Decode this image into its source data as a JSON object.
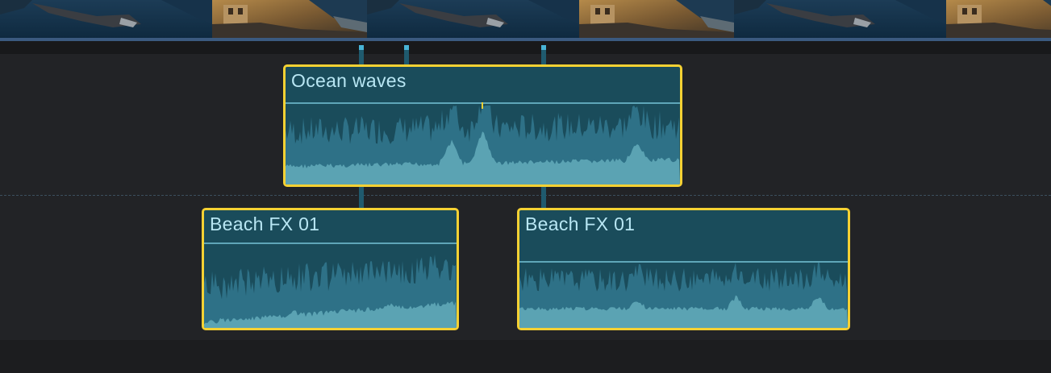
{
  "timeline": {
    "clips": [
      {
        "title": "Ocean waves",
        "selected": true
      },
      {
        "title": "Beach FX 01",
        "selected": true
      },
      {
        "title": "Beach FX 01",
        "selected": true
      }
    ]
  },
  "colors": {
    "selection_border": "#f5d133",
    "clip_fill": "#1a4c5b",
    "waveform": "#5ba3b3",
    "waveform_peaks": "#2e7187",
    "title_text": "#b8e6f3",
    "video_strip_border": "#3b5a80"
  }
}
